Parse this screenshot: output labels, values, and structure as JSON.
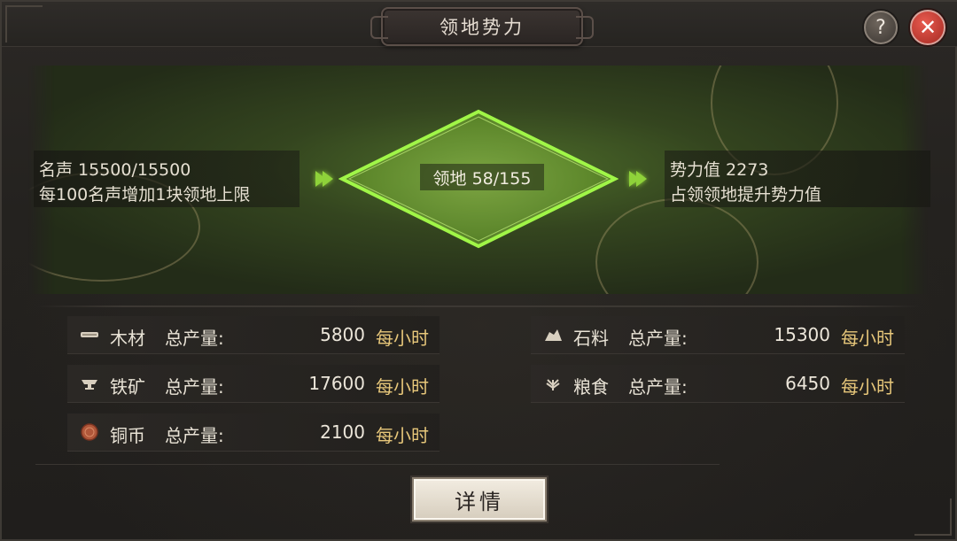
{
  "window": {
    "title": "领地势力"
  },
  "header": {
    "help_label": "?",
    "close_label": "✕"
  },
  "fame": {
    "line1": "名声 15500/15500",
    "line2": "每100名声增加1块领地上限"
  },
  "territory": {
    "label": "领地 58/155",
    "current": 58,
    "max": 155
  },
  "power": {
    "line1": "势力值 2273",
    "line2": "占领领地提升势力值"
  },
  "resources": [
    {
      "icon": "wood-icon",
      "name": "木材",
      "label": "总产量:",
      "value": "5800",
      "unit": "每小时"
    },
    {
      "icon": "stone-icon",
      "name": "石料",
      "label": "总产量:",
      "value": "15300",
      "unit": "每小时"
    },
    {
      "icon": "iron-icon",
      "name": "铁矿",
      "label": "总产量:",
      "value": "17600",
      "unit": "每小时"
    },
    {
      "icon": "grain-icon",
      "name": "粮食",
      "label": "总产量:",
      "value": "6450",
      "unit": "每小时"
    },
    {
      "icon": "coin-icon",
      "name": "铜币",
      "label": "总产量:",
      "value": "2100",
      "unit": "每小时"
    }
  ],
  "buttons": {
    "details": "详情"
  },
  "colors": {
    "territory_green": "#8fd23a",
    "unit_gold": "#e7c77a",
    "close_red": "#c9362c"
  }
}
